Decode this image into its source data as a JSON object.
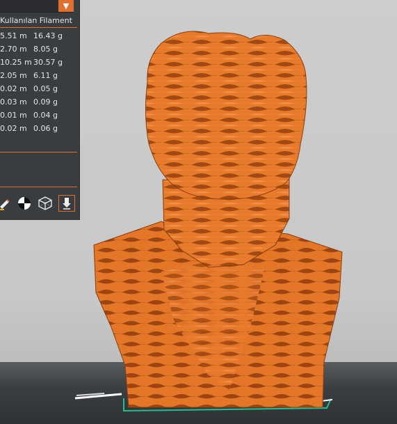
{
  "panel": {
    "dropdown_arrow": "▼",
    "filament_header": "Kullanılan Filament",
    "rows": [
      {
        "length": "5.51 m",
        "weight": "16.43 g"
      },
      {
        "length": "2.70 m",
        "weight": "8.05 g"
      },
      {
        "length": "10.25 m",
        "weight": "30.57 g"
      },
      {
        "length": "2.05 m",
        "weight": "6.11 g"
      },
      {
        "length": "0.02 m",
        "weight": "0.05 g"
      },
      {
        "length": "0.03 m",
        "weight": "0.09 g"
      },
      {
        "length": "0.01 m",
        "weight": "0.04 g"
      },
      {
        "length": "0.02 m",
        "weight": "0.06 g"
      }
    ],
    "tools": [
      "edit-icon",
      "center-of-gravity-icon",
      "wireframe-cube-icon",
      "export-icon"
    ]
  },
  "colors": {
    "accent": "#e07030",
    "model": "#e87a2c",
    "model_dark": "#a24a14",
    "panel_bg": "#3a3d40",
    "plate_outline": "#20c090"
  }
}
